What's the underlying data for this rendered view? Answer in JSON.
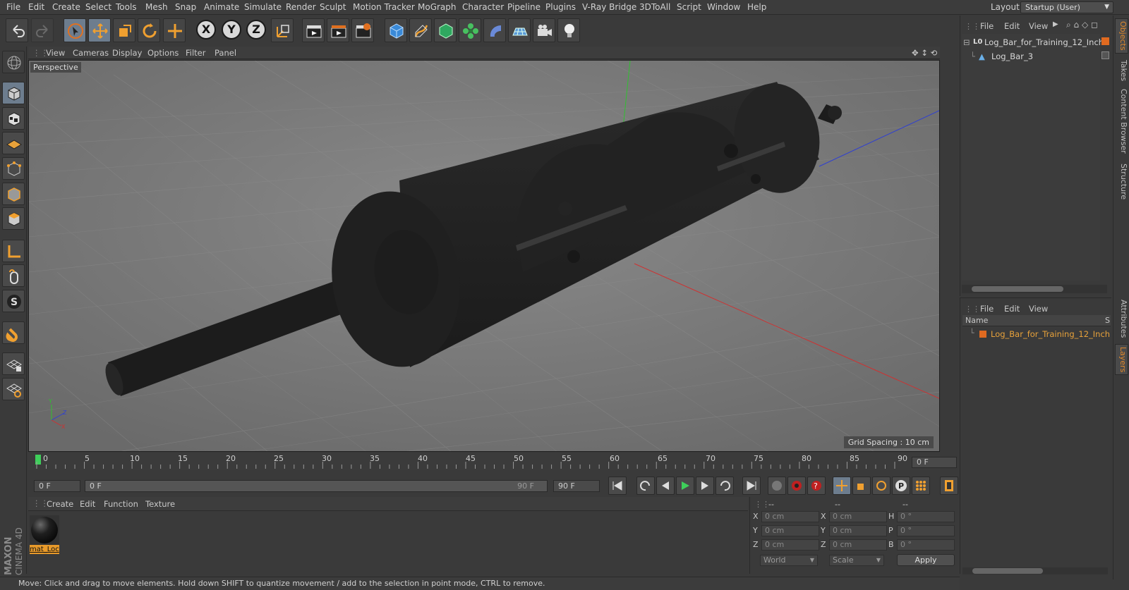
{
  "menubar": {
    "items": [
      "File",
      "Edit",
      "Create",
      "Select",
      "Tools",
      "Mesh",
      "Snap",
      "Animate",
      "Simulate",
      "Render",
      "Sculpt",
      "Motion Tracker",
      "MoGraph",
      "Character",
      "Pipeline",
      "Plugins",
      "V-Ray Bridge",
      "3DToAll",
      "Script",
      "Window",
      "Help"
    ],
    "layout_label": "Layout:",
    "layout_value": "Startup (User)"
  },
  "toolbar": {
    "axis_x": "X",
    "axis_y": "Y",
    "axis_z": "Z"
  },
  "viewport": {
    "menu": [
      "View",
      "Cameras",
      "Display",
      "Options",
      "Filter",
      "Panel"
    ],
    "label": "Perspective",
    "grid_spacing": "Grid Spacing : 10 cm"
  },
  "timeline": {
    "ticks": [
      "0",
      "5",
      "10",
      "15",
      "20",
      "25",
      "30",
      "35",
      "40",
      "45",
      "50",
      "55",
      "60",
      "65",
      "70",
      "75",
      "80",
      "85",
      "90"
    ],
    "current_frame_right": "0 F",
    "start_field": "0 F",
    "range_start": "0 F",
    "range_end": "90 F",
    "end_field": "90 F"
  },
  "material_manager": {
    "menu": [
      "Create",
      "Edit",
      "Function",
      "Texture"
    ],
    "material_name": "mat_Loc"
  },
  "coordinates": {
    "header": [
      "--",
      "--",
      "--"
    ],
    "rows": [
      {
        "a": "X",
        "av": "0 cm",
        "b": "X",
        "bv": "0 cm",
        "c": "H",
        "cv": "0 °"
      },
      {
        "a": "Y",
        "av": "0 cm",
        "b": "Y",
        "bv": "0 cm",
        "c": "P",
        "cv": "0 °"
      },
      {
        "a": "Z",
        "av": "0 cm",
        "b": "Z",
        "bv": "0 cm",
        "c": "B",
        "cv": "0 °"
      }
    ],
    "mode_world": "World",
    "mode_scale": "Scale",
    "apply": "Apply"
  },
  "status": "Move: Click and drag to move elements. Hold down SHIFT to quantize movement / add to the selection in point mode, CTRL to remove.",
  "objects": {
    "menu": [
      "File",
      "Edit",
      "View"
    ],
    "items": [
      {
        "name": "Log_Bar_for_Training_12_Inch",
        "level": 0
      },
      {
        "name": "Log_Bar_3",
        "level": 1
      }
    ]
  },
  "layers": {
    "menu": [
      "File",
      "Edit",
      "View"
    ],
    "col_name": "Name",
    "col_s": "S",
    "items": [
      "Log_Bar_for_Training_12_Inch"
    ]
  },
  "right_tabs": [
    "Objects",
    "Takes",
    "Content Browser",
    "Structure",
    "Attributes",
    "Layers"
  ],
  "brand": {
    "line1": "MAXON",
    "line2": "CINEMA 4D"
  }
}
